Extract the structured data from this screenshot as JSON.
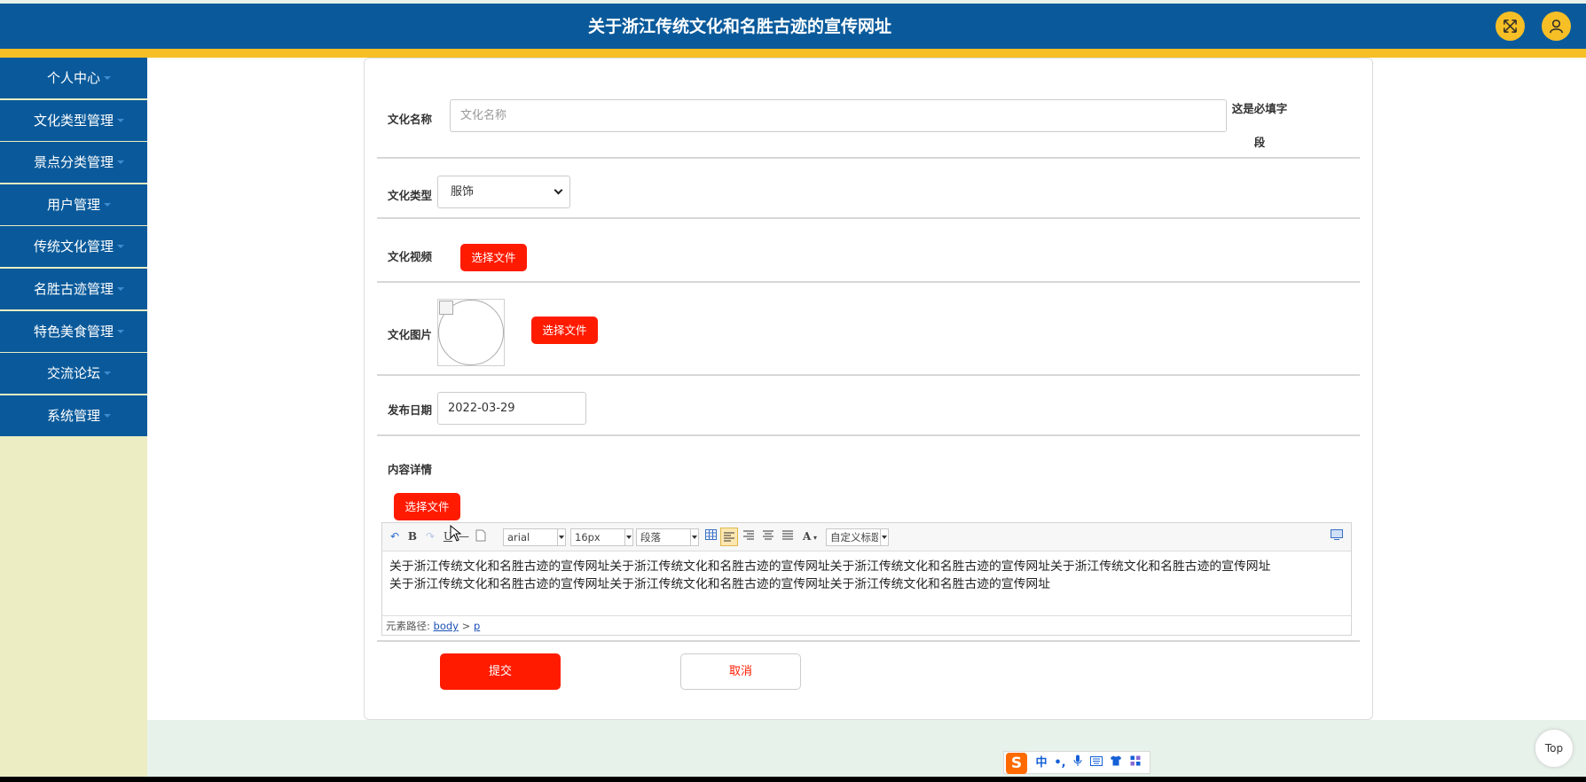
{
  "header": {
    "title": "关于浙江传统文化和名胜古迹的宣传网址",
    "fullscreen_icon": "expand-icon",
    "user_icon": "user-icon",
    "bar_color": "#0a5a9b",
    "accent_color": "#f6bf26"
  },
  "sidebar": {
    "items": [
      {
        "label": "个人中心"
      },
      {
        "label": "文化类型管理"
      },
      {
        "label": "景点分类管理"
      },
      {
        "label": "用户管理"
      },
      {
        "label": "传统文化管理"
      },
      {
        "label": "名胜古迹管理"
      },
      {
        "label": "特色美食管理"
      },
      {
        "label": "交流论坛"
      },
      {
        "label": "系统管理"
      }
    ]
  },
  "form": {
    "name_label": "文化名称",
    "name_placeholder": "文化名称",
    "name_value": "",
    "required_hint_line1": "这是必填字",
    "required_hint_line2": "段",
    "type_label": "文化类型",
    "type_value": "服饰",
    "video_label": "文化视频",
    "choose_file_label": "选择文件",
    "image_label": "文化图片",
    "date_label": "发布日期",
    "date_value": "2022-03-29",
    "content_label": "内容详情",
    "submit_label": "提交",
    "cancel_label": "取消"
  },
  "editor": {
    "font_family": "arial",
    "font_size": "16px",
    "paragraph": "段落",
    "custom_title": "自定义标题",
    "bold": "B",
    "underline": "U",
    "font_color": "A",
    "line1": "关于浙江传统文化和名胜古迹的宣传网址关于浙江传统文化和名胜古迹的宣传网址关于浙江传统文化和名胜古迹的宣传网址关于浙江传统文化和名胜古迹的宣传网址",
    "line2": "关于浙江传统文化和名胜古迹的宣传网址关于浙江传统文化和名胜古迹的宣传网址关于浙江传统文化和名胜古迹的宣传网址",
    "path_label": "元素路径:",
    "path_body": "body",
    "path_sep": ">",
    "path_p": "p"
  },
  "footer": {
    "top_label": "Top"
  },
  "ime": {
    "logo": "S",
    "mode": "中",
    "punct": "•,"
  }
}
